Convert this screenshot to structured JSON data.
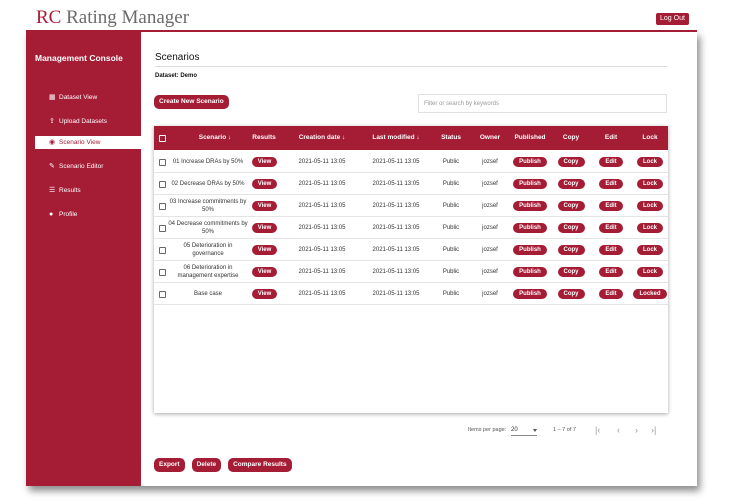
{
  "header": {
    "brand_short": "RC",
    "brand_name": "Rating Manager",
    "logout_label": "Log Out"
  },
  "sidebar": {
    "title": "Management Console",
    "items": [
      {
        "label": "Dataset View",
        "icon": "table-icon",
        "glyph": "▦",
        "active": false
      },
      {
        "label": "Upload Datasets",
        "icon": "upload-icon",
        "glyph": "⇪",
        "active": false
      },
      {
        "label": "Scenario View",
        "icon": "eye-icon",
        "glyph": "◉",
        "active": true
      },
      {
        "label": "Scenario Editor",
        "icon": "edit-icon",
        "glyph": "✎",
        "active": false
      },
      {
        "label": "Results",
        "icon": "list-icon",
        "glyph": "☰",
        "active": false
      },
      {
        "label": "Profile",
        "icon": "user-icon",
        "glyph": "●",
        "active": false
      }
    ]
  },
  "main": {
    "title": "Scenarios",
    "dataset_label": "Dataset: Demo",
    "create_label": "Create New Scenario",
    "search_placeholder": "Filter or search by keywords"
  },
  "table": {
    "headers": {
      "scenario": "Scenario ↓",
      "results": "Results",
      "created": "Creation date ↓",
      "modified": "Last modified ↓",
      "status": "Status",
      "owner": "Owner",
      "published": "Published",
      "copy": "Copy",
      "edit": "Edit",
      "lock": "Lock"
    },
    "rows": [
      {
        "scenario": "01 Increase DRAs by 50%",
        "results": "View",
        "created": "2021-05-11 13:05",
        "modified": "2021-05-11 13:05",
        "status": "Public",
        "owner": "jozsef",
        "published": "Publish",
        "copy": "Copy",
        "edit": "Edit",
        "lock": "Lock"
      },
      {
        "scenario": "02 Decrease DRAs by 50%",
        "results": "View",
        "created": "2021-05-11 13:05",
        "modified": "2021-05-11 13:05",
        "status": "Public",
        "owner": "jozsef",
        "published": "Publish",
        "copy": "Copy",
        "edit": "Edit",
        "lock": "Lock"
      },
      {
        "scenario": "03 Increase commitments by 50%",
        "results": "View",
        "created": "2021-05-11 13:05",
        "modified": "2021-05-11 13:05",
        "status": "Public",
        "owner": "jozsef",
        "published": "Publish",
        "copy": "Copy",
        "edit": "Edit",
        "lock": "Lock"
      },
      {
        "scenario": "04 Decrease commitments by 50%",
        "results": "View",
        "created": "2021-05-11 13:05",
        "modified": "2021-05-11 13:05",
        "status": "Public",
        "owner": "jozsef",
        "published": "Publish",
        "copy": "Copy",
        "edit": "Edit",
        "lock": "Lock"
      },
      {
        "scenario": "05 Deterioration in governance",
        "results": "View",
        "created": "2021-05-11 13:05",
        "modified": "2021-05-11 13:05",
        "status": "Public",
        "owner": "jozsef",
        "published": "Publish",
        "copy": "Copy",
        "edit": "Edit",
        "lock": "Lock"
      },
      {
        "scenario": "06 Deterioration in management expertise",
        "results": "View",
        "created": "2021-05-11 13:05",
        "modified": "2021-05-11 13:05",
        "status": "Public",
        "owner": "jozsef",
        "published": "Publish",
        "copy": "Copy",
        "edit": "Edit",
        "lock": "Lock"
      },
      {
        "scenario": "Base case",
        "results": "View",
        "created": "2021-05-11 13:05",
        "modified": "2021-05-11 13:05",
        "status": "Public",
        "owner": "jozsef",
        "published": "Publish",
        "copy": "Copy",
        "edit": "Edit",
        "lock": "Locked"
      }
    ]
  },
  "paginator": {
    "items_per_page_label": "Items per page:",
    "page_size": "20",
    "range_label": "1 – 7 of 7",
    "first_glyph": "|‹",
    "prev_glyph": "‹",
    "next_glyph": "›",
    "last_glyph": "›|"
  },
  "footer": {
    "export_label": "Export",
    "delete_label": "Delete",
    "compare_label": "Compare Results"
  },
  "colors": {
    "accent": "#a51c35"
  }
}
